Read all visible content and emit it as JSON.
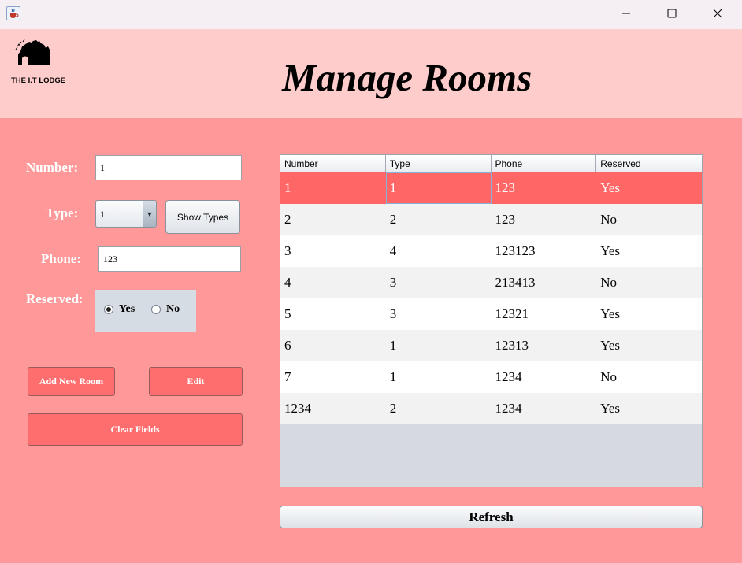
{
  "window": {
    "icon": "java-cup-icon",
    "controls": [
      "minimize-icon",
      "maximize-icon",
      "close-icon"
    ]
  },
  "header": {
    "logo_text": "THE I.T LODGE",
    "title": "Manage Rooms"
  },
  "form": {
    "number_label": "Number:",
    "number_value": "1",
    "type_label": "Type:",
    "type_value": "1",
    "show_types_label": "Show Types",
    "phone_label": "Phone:",
    "phone_value": "123",
    "reserved_label": "Reserved:",
    "reserved_yes": "Yes",
    "reserved_no": "No",
    "reserved_selected": "Yes",
    "add_label": "Add New Room",
    "edit_label": "Edit",
    "clear_label": "Clear Fields"
  },
  "table": {
    "columns": [
      "Number",
      "Type",
      "Phone",
      "Reserved"
    ],
    "rows": [
      [
        "1",
        "1",
        "123",
        "Yes"
      ],
      [
        "2",
        "2",
        "123",
        "No"
      ],
      [
        "3",
        "4",
        "123123",
        "Yes"
      ],
      [
        "4",
        "3",
        "213413",
        "No"
      ],
      [
        "5",
        "3",
        "12321",
        "Yes"
      ],
      [
        "6",
        "1",
        "12313",
        "Yes"
      ],
      [
        "7",
        "1",
        "1234",
        "No"
      ],
      [
        "1234",
        "2",
        "1234",
        "Yes"
      ]
    ],
    "selected_row": 0,
    "row_colors": {
      "selected": "#ff6666",
      "odd": "#ffffff",
      "even": "#f2f2f2"
    }
  },
  "refresh_label": "Refresh",
  "colors": {
    "background": "#ff9999",
    "header": "#ffcccc",
    "button": "#ff6e6e"
  }
}
